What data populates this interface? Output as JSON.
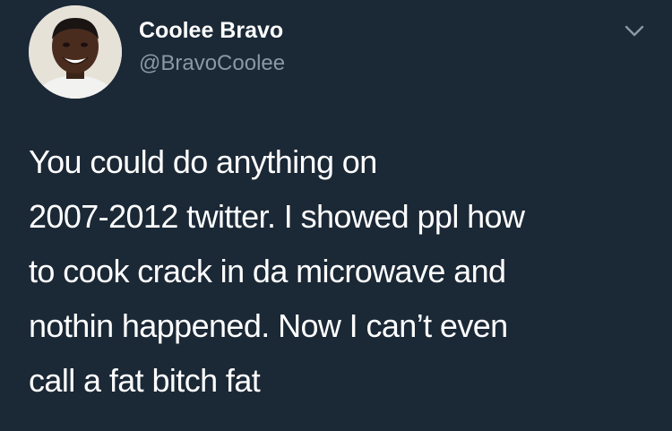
{
  "tweet": {
    "author": {
      "display_name": "Coolee Bravo",
      "handle": "@BravoCoolee"
    },
    "text": "You could do anything on\n2007-2012 twitter. I showed ppl how\nto cook crack in da microwave and\nnothin happened. Now I can’t even\ncall a fat bitch fat",
    "menu_icon": "chevron-down-icon"
  },
  "colors": {
    "background": "#1b2836",
    "text": "#ffffff",
    "secondary_text": "#8899a6"
  }
}
